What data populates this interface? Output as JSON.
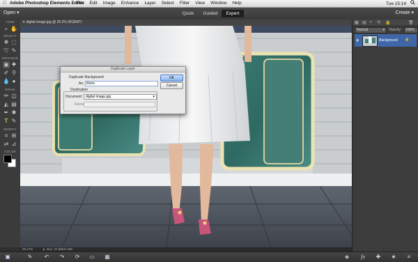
{
  "menubar": {
    "apple": "",
    "app_name": "Adobe Photoshop Elements Editor",
    "menus": [
      "File",
      "Edit",
      "Image",
      "Enhance",
      "Layer",
      "Select",
      "Filter",
      "View",
      "Window",
      "Help"
    ],
    "clock": "Tue 15:14",
    "search_icon": "search-icon"
  },
  "topbar": {
    "open_label": "Open ▾",
    "modes": {
      "quick": "Quick",
      "guided": "Guided",
      "expert": "Expert"
    },
    "create_label": "Create ▾"
  },
  "toolpanel": {
    "sections": {
      "view": "VIEW",
      "select": "SELECT",
      "enhance": "ENHANCE",
      "draw": "DRAW",
      "modify": "MODIFY",
      "color": "COLOR"
    }
  },
  "document": {
    "tab_label": "✕ digital image.jpg @ 26.2% (RGB/8*)"
  },
  "statusbar": {
    "zoom": "26.17%",
    "doc_info": "Doc: 47.5M/47.5M"
  },
  "layers": {
    "blend_mode": "Normal",
    "opacity_label": "Opacity:",
    "opacity_value": "100%",
    "layer_name": "Background"
  },
  "dialog": {
    "title": "Duplicate Layer",
    "duplicate_label": "Duplicate:",
    "duplicate_value": "Background",
    "as_label": "As:",
    "as_value": "Retro",
    "destination_label": "Destination",
    "document_label": "Document:",
    "document_value": "digital image.jpg",
    "name_label": "Name:",
    "ok_label": "OK",
    "cancel_label": "Cancel"
  },
  "colors": {
    "accent_blue": "#2f6fd0",
    "layer_selected": "#3f67a8",
    "suitcase_teal": "#3f8078"
  }
}
